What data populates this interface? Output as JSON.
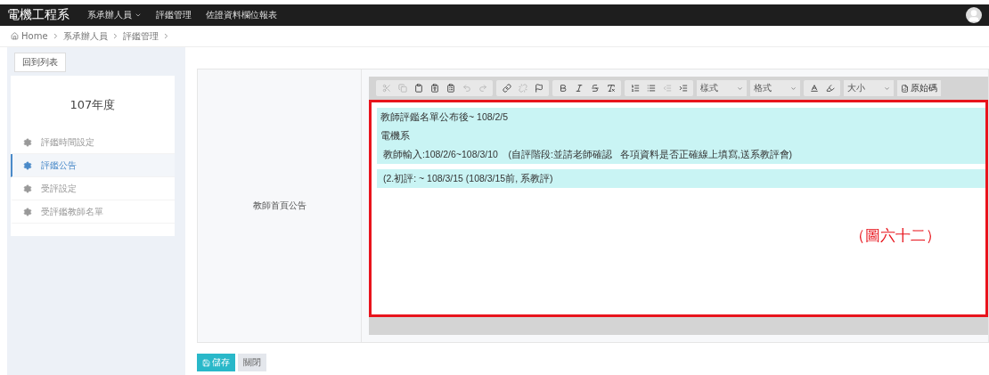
{
  "navbar": {
    "brand": "電機工程系",
    "items": [
      {
        "label": "系承辦人員",
        "dropdown": true
      },
      {
        "label": "評鑑管理",
        "dropdown": false
      },
      {
        "label": "佐證資料欄位報表",
        "dropdown": false
      }
    ]
  },
  "breadcrumb": [
    "Home",
    "系承辦人員",
    "評鑑管理"
  ],
  "back_button": "回到列表",
  "sidebar": {
    "title": "107年度",
    "items": [
      {
        "label": "評鑑時間設定",
        "selected": false
      },
      {
        "label": "評鑑公告",
        "selected": true
      },
      {
        "label": "受評設定",
        "selected": false
      },
      {
        "label": "受評鑑教師名單",
        "selected": false
      }
    ]
  },
  "form": {
    "label": "教師首頁公告",
    "toolbar": [
      {
        "kind": "group",
        "buttons": [
          {
            "kind": "cut",
            "disabled": true
          },
          {
            "kind": "copy",
            "disabled": true
          },
          {
            "kind": "paste",
            "disabled": false
          },
          {
            "kind": "paste-text",
            "disabled": false
          },
          {
            "kind": "paste-word",
            "disabled": false
          },
          {
            "kind": "undo",
            "disabled": true
          },
          {
            "kind": "redo",
            "disabled": true
          }
        ]
      },
      {
        "kind": "group",
        "buttons": [
          {
            "kind": "link",
            "disabled": false
          },
          {
            "kind": "unlink",
            "disabled": true
          },
          {
            "kind": "anchor",
            "disabled": false
          }
        ]
      },
      {
        "kind": "group",
        "buttons": [
          {
            "kind": "bold",
            "disabled": false
          },
          {
            "kind": "italic",
            "disabled": false
          },
          {
            "kind": "strike",
            "disabled": false
          },
          {
            "kind": "clear-format",
            "disabled": false
          }
        ]
      },
      {
        "kind": "group",
        "buttons": [
          {
            "kind": "ordered-list",
            "disabled": false
          },
          {
            "kind": "bullet-list",
            "disabled": false
          },
          {
            "kind": "outdent",
            "disabled": true
          },
          {
            "kind": "indent",
            "disabled": false
          }
        ]
      },
      {
        "kind": "select",
        "label": "樣式"
      },
      {
        "kind": "select",
        "label": "格式"
      },
      {
        "kind": "group",
        "buttons": [
          {
            "kind": "text-color",
            "disabled": false
          },
          {
            "kind": "bg-color",
            "disabled": false
          }
        ]
      },
      {
        "kind": "select",
        "label": "大小"
      },
      {
        "kind": "source",
        "label": "原始碼"
      }
    ],
    "content": [
      {
        "highlighted": true,
        "lines": [
          "教師評鑑名單公布後~ 108/2/5",
          "電機系",
          " 教師輸入:108/2/6~108/3/10    (自評階段:並請老師確認   各項資料是否正確線上填寫,送系教評會)"
        ]
      },
      {
        "highlighted": true,
        "lines": [
          " (2.初評: ~ 108/3/15 (108/3/15前, 系教評)"
        ]
      }
    ],
    "annotation": "（圖六十二）"
  },
  "buttons": [
    {
      "label": "儲存",
      "kind": "primary"
    },
    {
      "label": "關閉",
      "kind": "default"
    }
  ]
}
